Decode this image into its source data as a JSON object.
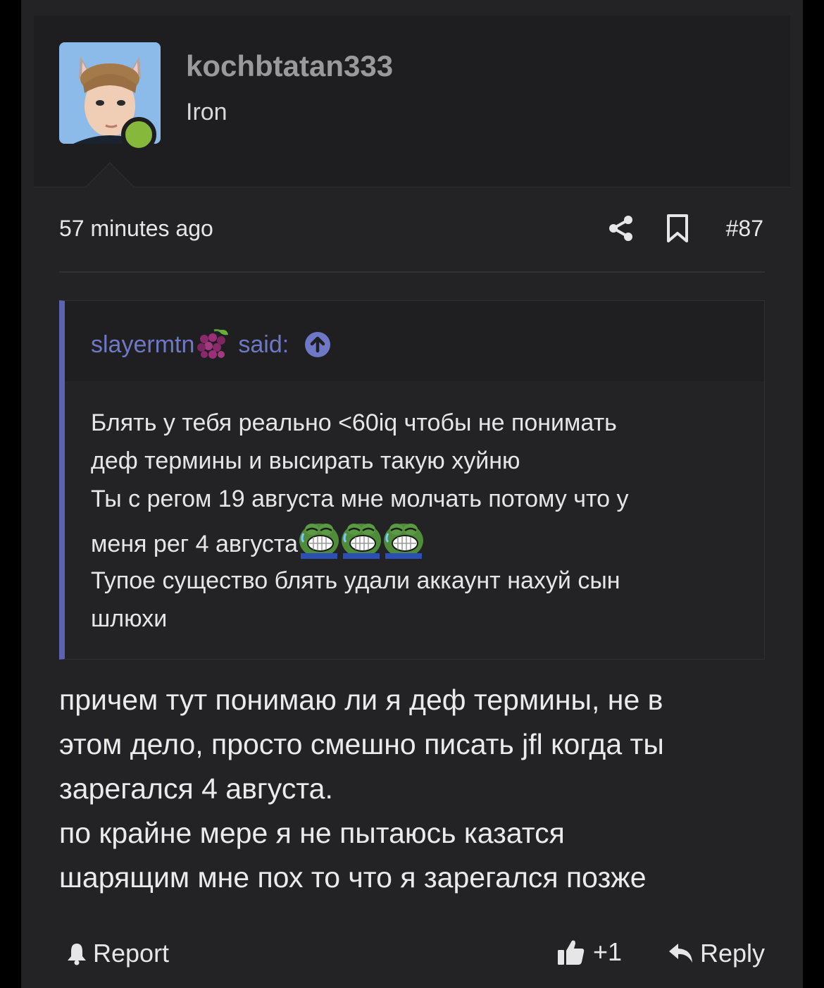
{
  "user": {
    "username": "kochbtatan333",
    "rank": "Iron",
    "status_color": "#86b83b"
  },
  "meta": {
    "timestamp": "57 minutes ago",
    "post_number": "#87",
    "icons": [
      "share-icon",
      "bookmark-icon"
    ]
  },
  "quote": {
    "author": "slayermtn",
    "author_emoji": "grapes",
    "said_label": "said:",
    "accent_color": "#5d62b2",
    "lines": [
      "Блять у тебя реально <60iq чтобы не понимать",
      "деф термины и высирать такую хуйню",
      "Ты с регом 19 августа мне молчать потому что у",
      "меня рег 4 августа",
      "Тупое существо блять удали аккаунт нахуй сын",
      "шлюхи"
    ],
    "emoji_after_line_4": [
      "laughing-pepe",
      "laughing-pepe",
      "laughing-pepe"
    ]
  },
  "message": {
    "lines": [
      "причем тут понимаю ли я деф термины, не в",
      "этом дело, просто смешно писать jfl когда ты",
      "зарегался 4 августа.",
      "по крайне мере я не пытаюсь казатся",
      "шарящим мне пох то что я зарегался позже"
    ]
  },
  "actions": {
    "report_label": "Report",
    "like_count": "+1",
    "reply_label": "Reply"
  }
}
